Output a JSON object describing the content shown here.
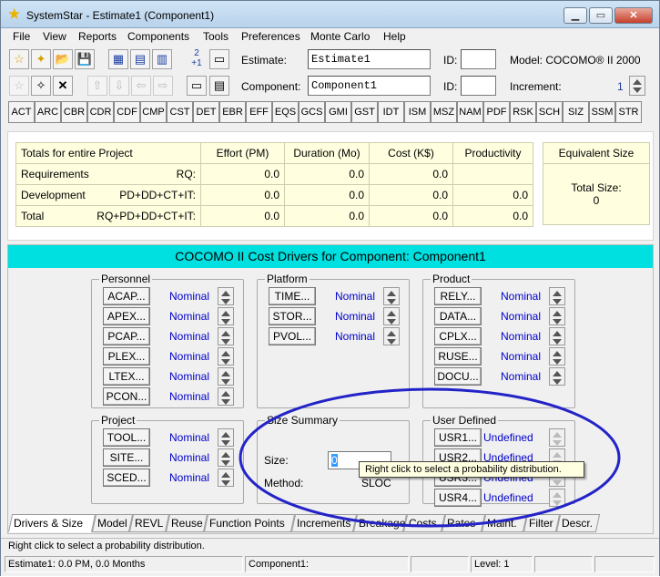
{
  "window": {
    "title": "SystemStar - Estimate1 (Component1)"
  },
  "menu": [
    "File",
    "View",
    "Reports",
    "Components",
    "Tools",
    "Preferences",
    "Monte Carlo",
    "Help"
  ],
  "toolbar": {
    "estimate_label": "Estimate:",
    "estimate_value": "Estimate1",
    "id_label": "ID:",
    "component_label": "Component:",
    "component_value": "Component1",
    "id2_label": "ID:",
    "model_text": "Model: COCOMO® II 2000",
    "increment_label": "Increment:",
    "increment_value": "1",
    "counter_top": "2",
    "counter_bottom": "+1"
  },
  "driver_tabs": [
    "ACT",
    "ARC",
    "CBR",
    "CDR",
    "CDF",
    "CMP",
    "CST",
    "DET",
    "EBR",
    "EFF",
    "EQS",
    "GCS",
    "GMI",
    "GST",
    "IDT",
    "ISM",
    "MSZ",
    "NAM",
    "PDF",
    "RSK",
    "SCH",
    "SIZ",
    "SSM",
    "STR"
  ],
  "totals": {
    "header": [
      "Totals for entire Project",
      "Effort (PM)",
      "Duration (Mo)",
      "Cost (K$)",
      "Productivity"
    ],
    "rows": [
      {
        "name": "Requirements",
        "code": "RQ:",
        "effort": "0.0",
        "duration": "0.0",
        "cost": "0.0",
        "productivity": ""
      },
      {
        "name": "Development",
        "code": "PD+DD+CT+IT:",
        "effort": "0.0",
        "duration": "0.0",
        "cost": "0.0",
        "productivity": "0.0"
      },
      {
        "name": "Total",
        "code": "RQ+PD+DD+CT+IT:",
        "effort": "0.0",
        "duration": "0.0",
        "cost": "0.0",
        "productivity": "0.0"
      }
    ]
  },
  "equivalent_size": {
    "title": "Equivalent Size",
    "label": "Total Size:",
    "value": "0"
  },
  "cost_drivers": {
    "header": "COCOMO II Cost Drivers for Component: Component1",
    "personnel": {
      "title": "Personnel",
      "items": [
        {
          "label": "ACAP...",
          "value": "Nominal"
        },
        {
          "label": "APEX...",
          "value": "Nominal"
        },
        {
          "label": "PCAP...",
          "value": "Nominal"
        },
        {
          "label": "PLEX...",
          "value": "Nominal"
        },
        {
          "label": "LTEX...",
          "value": "Nominal"
        },
        {
          "label": "PCON...",
          "value": "Nominal"
        }
      ]
    },
    "platform": {
      "title": "Platform",
      "items": [
        {
          "label": "TIME...",
          "value": "Nominal"
        },
        {
          "label": "STOR...",
          "value": "Nominal"
        },
        {
          "label": "PVOL...",
          "value": "Nominal"
        }
      ]
    },
    "product": {
      "title": "Product",
      "items": [
        {
          "label": "RELY...",
          "value": "Nominal"
        },
        {
          "label": "DATA...",
          "value": "Nominal"
        },
        {
          "label": "CPLX...",
          "value": "Nominal"
        },
        {
          "label": "RUSE...",
          "value": "Nominal"
        },
        {
          "label": "DOCU...",
          "value": "Nominal"
        }
      ]
    },
    "project": {
      "title": "Project",
      "items": [
        {
          "label": "TOOL...",
          "value": "Nominal"
        },
        {
          "label": "SITE...",
          "value": "Nominal"
        },
        {
          "label": "SCED...",
          "value": "Nominal"
        }
      ]
    },
    "size_summary": {
      "title": "Size Summary",
      "size_label": "Size:",
      "size_value": "0",
      "method_label": "Method:",
      "method_value": "SLOC"
    },
    "user_defined": {
      "title": "User Defined",
      "items": [
        {
          "label": "USR1...",
          "value": "Undefined"
        },
        {
          "label": "USR2...",
          "value": "Undefined"
        },
        {
          "label": "USR3...",
          "value": "Undefined"
        },
        {
          "label": "USR4...",
          "value": "Undefined"
        }
      ]
    }
  },
  "tooltip": "Right click to select a probability distribution.",
  "bottom_tabs": [
    "Drivers & Size",
    "Model",
    "REVL",
    "Reuse",
    "Function Points",
    "Increments",
    "Breakage",
    "Costs",
    "Rates",
    "Maint.",
    "Filter",
    "Descr."
  ],
  "status": {
    "message": "Right click to select a probability distribution.",
    "estimate": "Estimate1:  0.0 PM,  0.0 Months",
    "component": "Component1:",
    "level": "Level:  1"
  }
}
